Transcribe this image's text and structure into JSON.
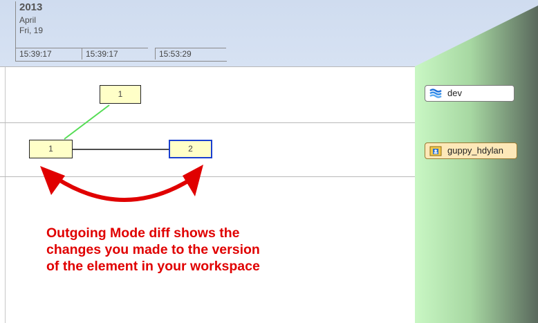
{
  "timeline": {
    "year": "2013",
    "month": "April",
    "day": "Fri, 19",
    "times": [
      "15:39:17",
      "15:39:17",
      "15:53:29"
    ]
  },
  "versions": {
    "parent": "1",
    "workspace_base": "1",
    "workspace_current": "2"
  },
  "branches": {
    "dev": {
      "label": "dev",
      "icon": "stream-icon"
    },
    "workspace": {
      "label": "guppy_hdylan",
      "icon": "workspace-folder-icon"
    }
  },
  "annotation": {
    "lines": [
      "Outgoing Mode diff shows the",
      "changes you made to the version",
      "of the element in  your workspace"
    ]
  },
  "colors": {
    "annotation": "#e00000",
    "selected_border": "#1a3fcf",
    "merge_line": "#55dd55",
    "node_fill": "#ffffc8"
  }
}
